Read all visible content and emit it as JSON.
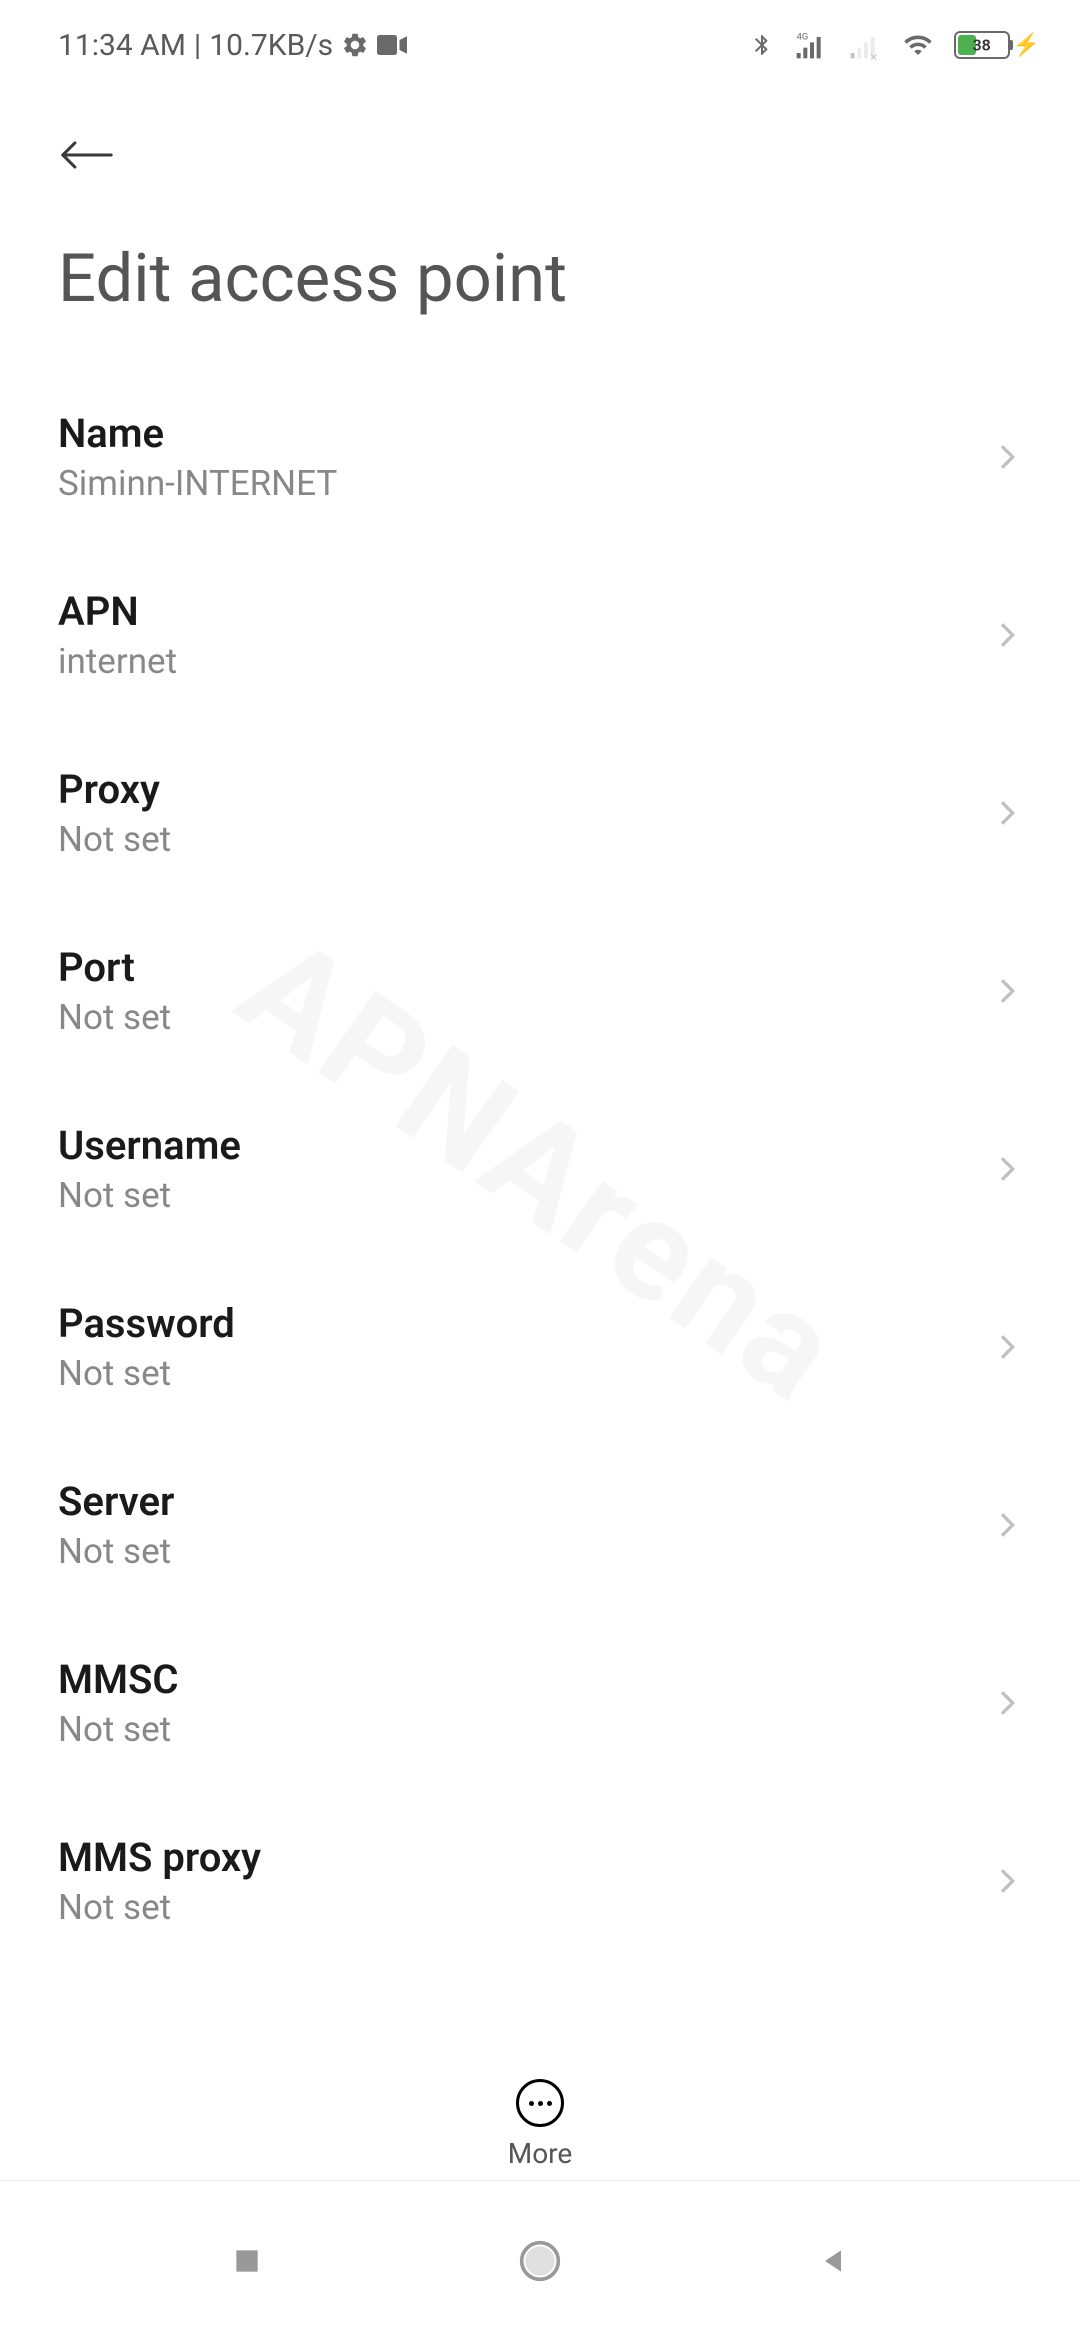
{
  "statusBar": {
    "time": "11:34 AM",
    "separator": "|",
    "dataRate": "10.7KB/s",
    "batteryLevel": "38"
  },
  "header": {
    "title": "Edit access point"
  },
  "settings": [
    {
      "label": "Name",
      "value": "Siminn-INTERNET"
    },
    {
      "label": "APN",
      "value": "internet"
    },
    {
      "label": "Proxy",
      "value": "Not set"
    },
    {
      "label": "Port",
      "value": "Not set"
    },
    {
      "label": "Username",
      "value": "Not set"
    },
    {
      "label": "Password",
      "value": "Not set"
    },
    {
      "label": "Server",
      "value": "Not set"
    },
    {
      "label": "MMSC",
      "value": "Not set"
    },
    {
      "label": "MMS proxy",
      "value": "Not set"
    }
  ],
  "bottomBar": {
    "moreLabel": "More"
  },
  "watermark": "APNArena"
}
